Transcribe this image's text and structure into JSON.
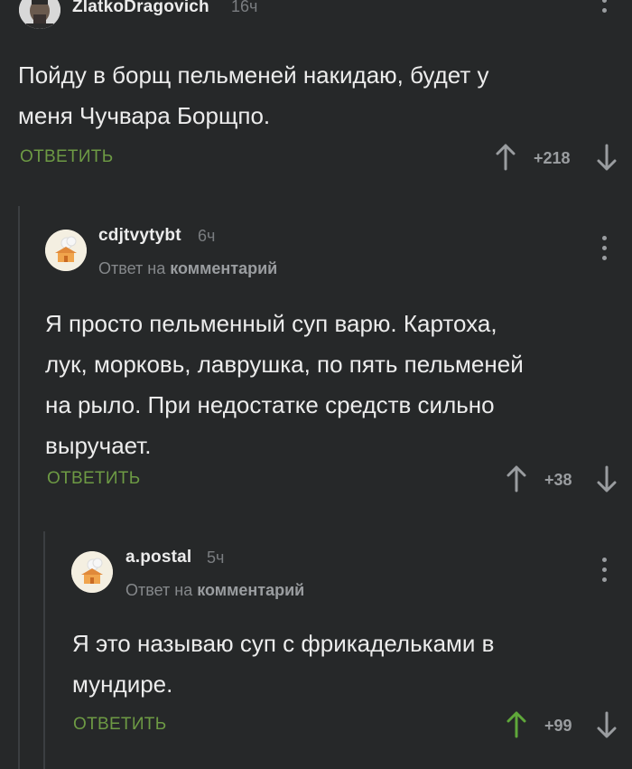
{
  "comments": [
    {
      "username": "ZlatkoDragovich",
      "time": "16ч",
      "text_lines": [
        "Пойду в борщ пельменей накидаю, будет у",
        "меня Чучвара Борщпо."
      ],
      "reply_label": "ОТВЕТИТЬ",
      "score": "+218",
      "upvoted": false
    },
    {
      "username": "cdjtvytybt",
      "time": "6ч",
      "reply_prefix": "Ответ на",
      "reply_target": "комментарий",
      "text_lines": [
        "Я просто пельменный суп варю. Картоха,",
        "лук, морковь, лаврушка, по пять пельменей",
        "на рыло. При недостатке средств сильно",
        "выручает."
      ],
      "reply_label": "ОТВЕТИТЬ",
      "score": "+38",
      "upvoted": false
    },
    {
      "username": "a.postal",
      "time": "5ч",
      "reply_prefix": "Ответ на",
      "reply_target": "комментарий",
      "text_lines": [
        "Я это называю суп с фрикадельками в",
        "мундире."
      ],
      "reply_label": "ОТВЕТИТЬ",
      "score": "+99",
      "upvoted": true
    }
  ],
  "colors": {
    "background": "#262829",
    "accent_green": "#6d9a44",
    "upvote_active": "#5fa83a",
    "muted": "#9a9da0"
  },
  "icons": [
    "avatar-photo",
    "avatar-default-house",
    "upvote-arrow",
    "downvote-arrow",
    "more-vertical-dots"
  ]
}
